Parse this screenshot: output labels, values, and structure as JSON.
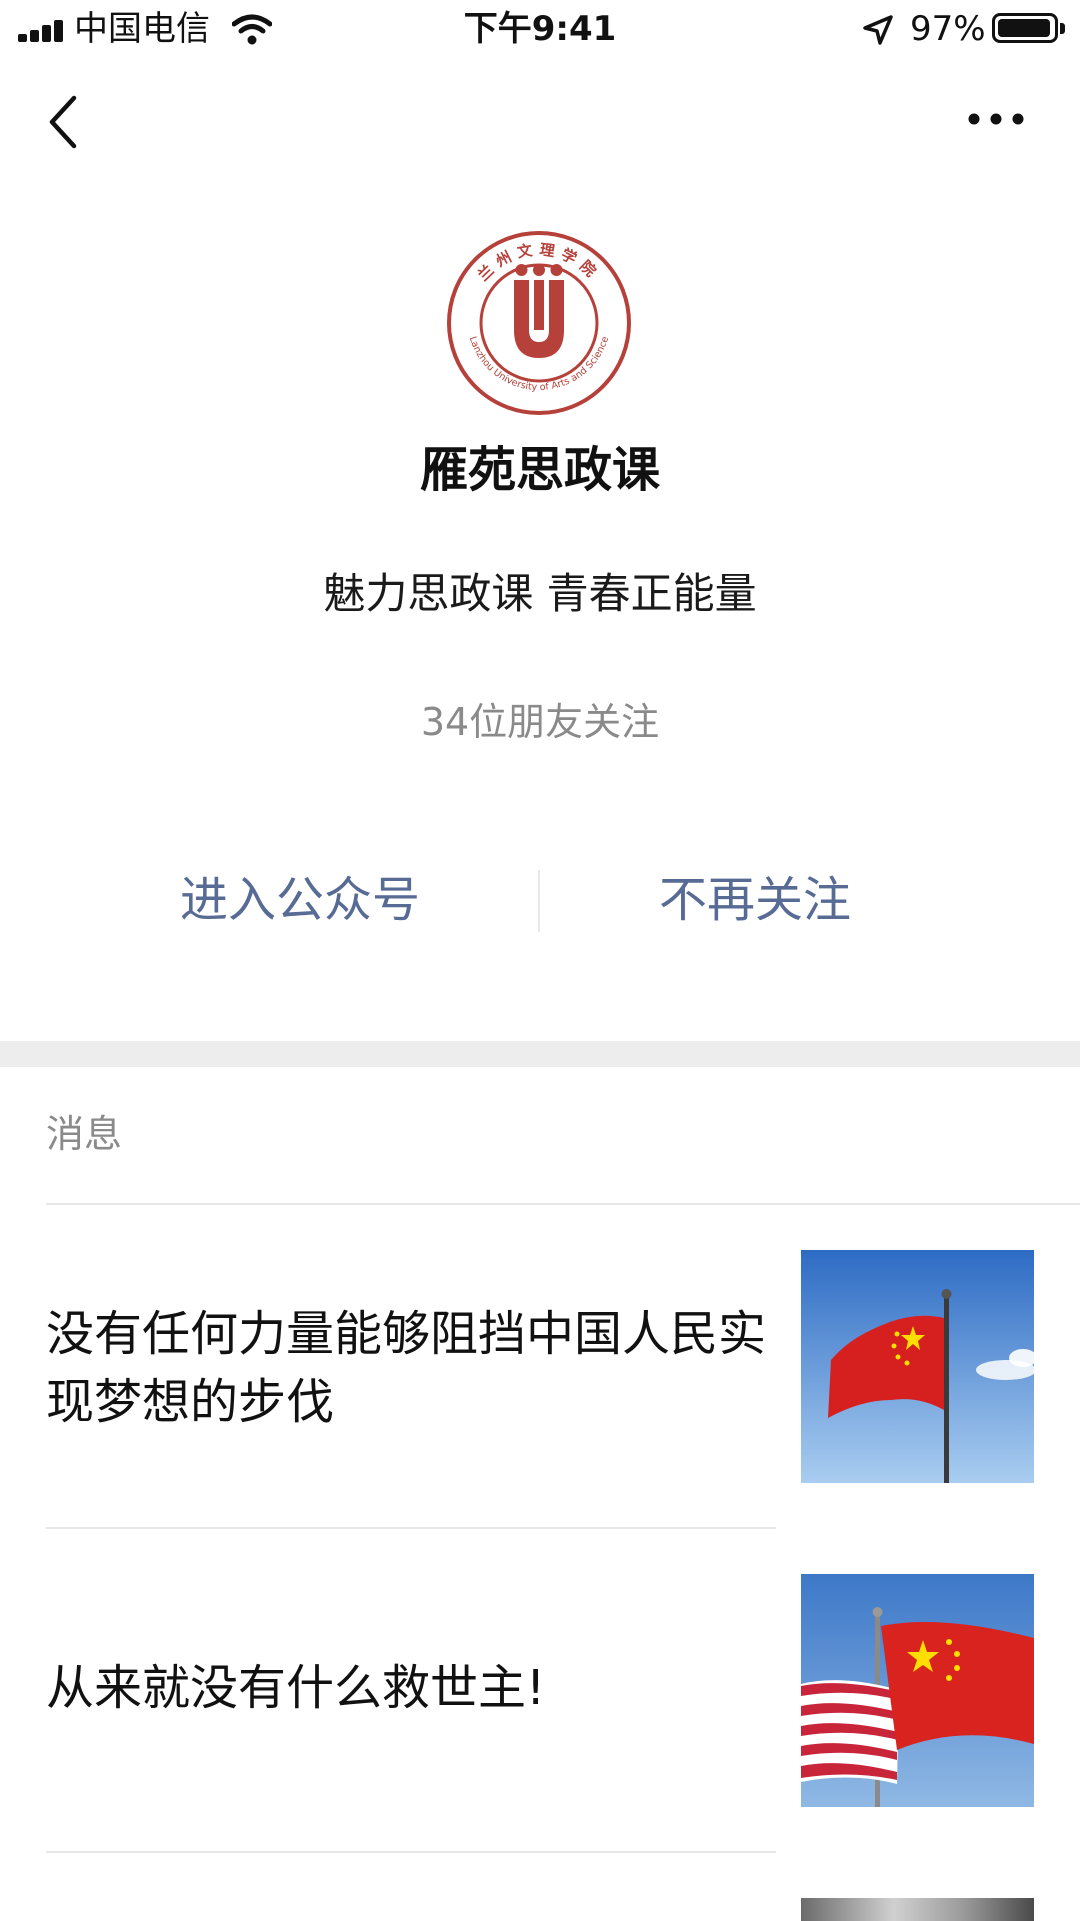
{
  "status_bar": {
    "carrier": "中国电信",
    "time": "下午9:41",
    "battery_percent": "97%",
    "battery_level": 0.97,
    "icons": [
      "signal-icon",
      "wifi-icon",
      "location-arrow-icon",
      "battery-icon"
    ]
  },
  "nav": {
    "back_icon": "chevron-left-icon",
    "more_icon": "more-dots-icon"
  },
  "profile": {
    "logo_icon": "university-seal-logo",
    "logo_text_top": "兰州文理学院",
    "logo_text_ring": "Lanzhou University of Arts and Science",
    "name": "雁苑思政课",
    "tagline": "魅力思政课  青春正能量",
    "followers": "34位朋友关注",
    "accent_color": "#576b95",
    "logo_color": "#b5413a"
  },
  "actions": {
    "enter_label": "进入公众号",
    "unfollow_label": "不再关注"
  },
  "messages": {
    "section_label": "消息",
    "items": [
      {
        "title": "没有任何力量能够阻挡中国人民实现梦想的步伐",
        "thumbnail": "chinese-flag-on-pole-photo"
      },
      {
        "title": "从来就没有什么救世主!",
        "thumbnail": "us-and-chinese-flags-photo"
      }
    ]
  }
}
